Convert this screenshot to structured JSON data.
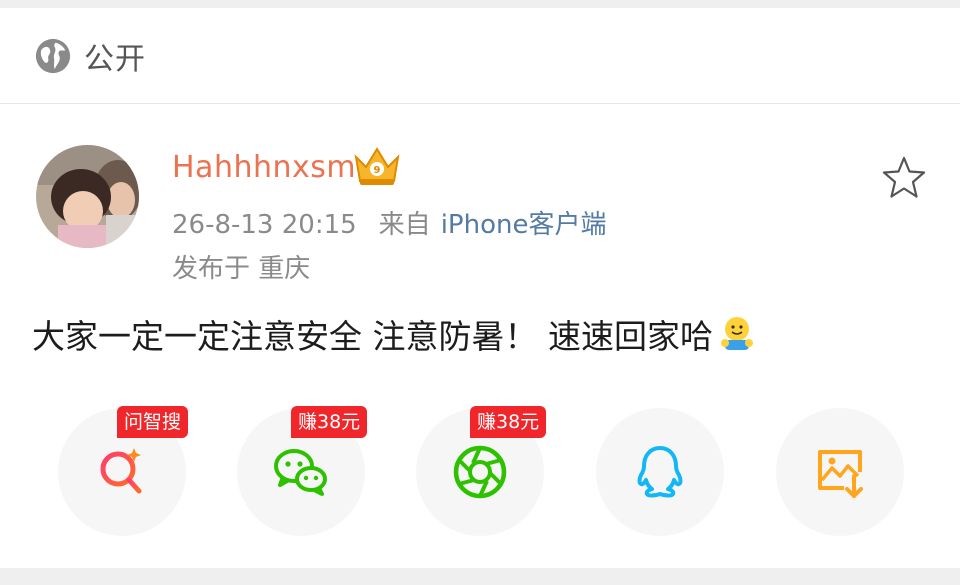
{
  "visibility": {
    "icon": "globe-icon",
    "label": "公开"
  },
  "post": {
    "username": "Hahhhnxsm",
    "time": "26-8-13 20:15",
    "from_label": "来自",
    "source": "iPhone客户端",
    "location": "发布于 重庆",
    "text": "大家一定一定注意安全 注意防暑！ 速速回家哈"
  },
  "share": [
    {
      "name": "search",
      "icon": "ai-search-icon",
      "badge": "问智搜"
    },
    {
      "name": "wechat",
      "icon": "wechat-icon",
      "badge": "赚38元"
    },
    {
      "name": "moments",
      "icon": "wechat-moments-icon",
      "badge": "赚38元"
    },
    {
      "name": "qq",
      "icon": "qq-icon",
      "badge": ""
    },
    {
      "name": "save-image",
      "icon": "save-image-icon",
      "badge": ""
    }
  ],
  "colors": {
    "username": "#eb7350",
    "source_link": "#537ba4",
    "badge": "#f0262b",
    "wechat": "#2dc100",
    "qq": "#12b7f5",
    "save": "#ffa51e"
  }
}
